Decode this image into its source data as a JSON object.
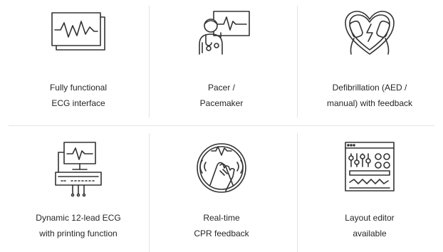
{
  "features": [
    {
      "line1": "Fully    functional",
      "line2": "ECG interface",
      "icon": "ecg-monitor-icon"
    },
    {
      "line1": "Pacer /",
      "line2": "Pacemaker",
      "icon": "pacemaker-doctor-icon"
    },
    {
      "line1": "Defibrillation (AED /",
      "line2": "manual) with feedback",
      "icon": "defibrillator-heart-icon"
    },
    {
      "line1": "Dynamic   12-lead   ECG",
      "line2": "with printing function",
      "icon": "ecg-printer-icon"
    },
    {
      "line1": "Real-time",
      "line2": "CPR feedback",
      "icon": "cpr-hands-icon"
    },
    {
      "line1": "Layout editor",
      "line2": "available",
      "icon": "layout-editor-icon"
    }
  ],
  "colors": {
    "icon_stroke": "#333333",
    "divider": "#e4e4e4",
    "text": "#262626"
  }
}
